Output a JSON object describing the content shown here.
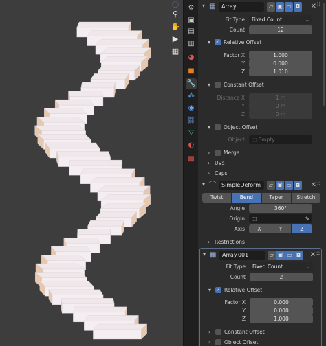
{
  "viewport": {
    "tools": [
      "zoom-icon",
      "hand-pan-icon",
      "camera-icon",
      "grid-icon"
    ],
    "colors": {
      "background": "#3d3d3d",
      "step_top": "#efe7ea",
      "step_side": "#e6c8b0",
      "step_front": "#f4eef2"
    }
  },
  "tabs": [
    "tool",
    "render",
    "output",
    "view-layer",
    "scene",
    "world",
    "object",
    "modifiers",
    "particles",
    "physics",
    "constraints",
    "data",
    "material",
    "texture"
  ],
  "modifiers": [
    {
      "name": "Array",
      "fit_type_label": "Fit Type",
      "fit_type": "Fixed Count",
      "count_label": "Count",
      "count": "12",
      "relative_offset": {
        "label": "Relative Offset",
        "factor_x_label": "Factor X",
        "factor_x": "1.000",
        "y_label": "Y",
        "y": "0.000",
        "z_label": "Z",
        "z": "1.010"
      },
      "constant_offset": {
        "label": "Constant Offset",
        "distance_x_label": "Distance X",
        "distance_x": "1 m",
        "y_label": "Y",
        "y": "0 m",
        "z_label": "Z",
        "z": "0 m"
      },
      "object_offset": {
        "label": "Object Offset",
        "object_label": "Object",
        "object_value": "Empty"
      },
      "merge": "Merge",
      "uvs": "UVs",
      "caps": "Caps"
    },
    {
      "name": "SimpleDeform",
      "modes": [
        "Twist",
        "Bend",
        "Taper",
        "Stretch"
      ],
      "active_mode": "Bend",
      "angle_label": "Angle",
      "angle": "360°",
      "origin_label": "Origin",
      "axis_label": "Axis",
      "axes": [
        "X",
        "Y",
        "Z"
      ],
      "active_axis": "Z",
      "restrictions": "Restrictions"
    },
    {
      "name": "Array.001",
      "fit_type_label": "Fit Type",
      "fit_type": "Fixed Count",
      "count_label": "Count",
      "count": "2",
      "relative_offset": {
        "label": "Relative Offset",
        "factor_x_label": "Factor X",
        "factor_x": "0.000",
        "y_label": "Y",
        "y": "0.000",
        "z_label": "Z",
        "z": "1.000"
      },
      "constant_offset": {
        "label": "Constant Offset"
      },
      "object_offset": {
        "label": "Object Offset"
      }
    }
  ],
  "accent": "#4772b3"
}
